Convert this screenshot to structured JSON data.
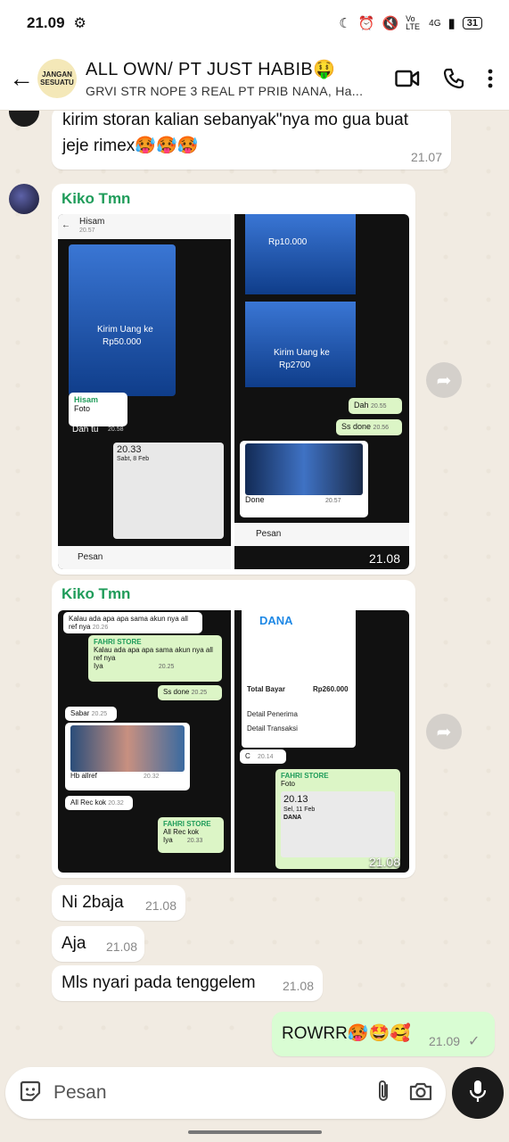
{
  "status": {
    "time": "21.09",
    "network": "4G",
    "volte": "Vo LTE",
    "battery": "31"
  },
  "header": {
    "title": "ALL OWN/ PT JUST HABIB🤑",
    "subtitle": "GRVI STR NOPE 3 REAL PT PRIB NANA, Ha...",
    "avatar_text": "JANGAN SESUATU"
  },
  "messages": {
    "m1": {
      "text": "kirim storan kalian sebanyak\"nya mo gua buat jeje rimex🥵🥵🥵",
      "time": "21.07"
    },
    "album1": {
      "sender": "Kiko Tmn",
      "time": "21.08",
      "t1": {
        "name": "Hisam",
        "time": "20.57",
        "amount": "Rp50.000",
        "caption": "Kirim Uang ke",
        "reply_name": "Hisam",
        "reply_label": "Foto",
        "reply_text": "Dah tu",
        "reply_time": "20.58",
        "lock_time": "20.33",
        "lock_date": "Sabt, 8 Feb",
        "input": "Pesan"
      },
      "t2": {
        "amount1": "Rp10.000",
        "amount2": "Rp2700",
        "caption": "Kirim Uang ke",
        "chip1": "Dah",
        "chip1_time": "20.55",
        "chip2": "Ss done",
        "chip2_time": "20.56",
        "done": "Done",
        "done_time": "20.57",
        "input": "Pesan"
      }
    },
    "album2": {
      "sender": "Kiko Tmn",
      "time": "21.08",
      "t3": {
        "m1": "Kalau ada apa apa sama akun nya all ref nya",
        "m1_time": "20.26",
        "quote_name": "FAHRI STORE",
        "quote_text": "Kalau ada apa apa sama akun nya all ref nya",
        "quote_reply": "Iya",
        "quote_time": "20.25",
        "ss": "Ss done",
        "ss_time": "20.25",
        "sabar": "Sabar",
        "sabar_time": "20.25",
        "hb": "Hb allref",
        "hb_time": "20.32",
        "all": "All Rec kok",
        "all_time": "20.32",
        "q2_name": "FAHRI STORE",
        "q2_text": "All Rec kok",
        "q2_reply": "Iya",
        "q2_time": "20.33"
      },
      "t4": {
        "brand": "DANA",
        "total": "Total Bayar",
        "total_amount": "Rp260.000",
        "detail1": "Detail Penerima",
        "detail2": "Detail Transaksi",
        "c": "C",
        "c_time": "20.14",
        "quote_name": "FAHRI STORE",
        "quote_label": "Foto",
        "lock_time": "20.13",
        "lock_date": "Sel, 11 Feb",
        "notif": "DANA"
      }
    },
    "m2": {
      "text": "Ni 2baja",
      "time": "21.08"
    },
    "m3": {
      "text": "Aja",
      "time": "21.08"
    },
    "m4": {
      "text": "Mls nyari pada tenggelem",
      "time": "21.08"
    },
    "m5": {
      "text": "ROWRR🥵🤩🥰",
      "time": "21.09",
      "ticks": "✓"
    }
  },
  "input": {
    "placeholder": "Pesan"
  },
  "colors": {
    "sender": "#1f9c5a",
    "outgoing": "#d9fdd3",
    "wallpaper": "#f1ebe2"
  }
}
